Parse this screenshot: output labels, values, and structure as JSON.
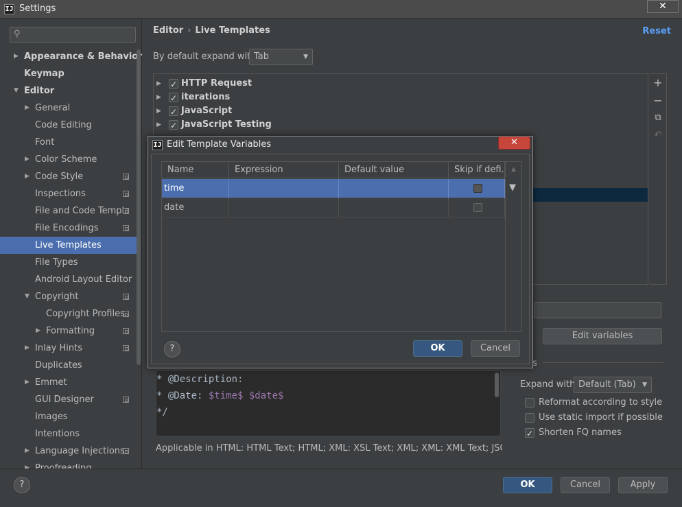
{
  "window": {
    "title": "Settings",
    "app_icon": "IJ",
    "close_glyph": "✕"
  },
  "search": {
    "placeholder": "",
    "icon": "search-icon"
  },
  "sidebar": {
    "items": [
      {
        "label": "Appearance & Behavior",
        "level": 0,
        "arrow": "▶",
        "bold": true
      },
      {
        "label": "Keymap",
        "level": 0,
        "arrow": "",
        "bold": true
      },
      {
        "label": "Editor",
        "level": 0,
        "arrow": "▼",
        "bold": true
      },
      {
        "label": "General",
        "level": 1,
        "arrow": "▶"
      },
      {
        "label": "Code Editing",
        "level": 1,
        "arrow": ""
      },
      {
        "label": "Font",
        "level": 1,
        "arrow": ""
      },
      {
        "label": "Color Scheme",
        "level": 1,
        "arrow": "▶"
      },
      {
        "label": "Code Style",
        "level": 1,
        "arrow": "▶",
        "project": true
      },
      {
        "label": "Inspections",
        "level": 1,
        "arrow": "",
        "project": true
      },
      {
        "label": "File and Code Templa",
        "level": 1,
        "arrow": "",
        "project": true
      },
      {
        "label": "File Encodings",
        "level": 1,
        "arrow": "",
        "project": true
      },
      {
        "label": "Live Templates",
        "level": 1,
        "arrow": "",
        "selected": true
      },
      {
        "label": "File Types",
        "level": 1,
        "arrow": ""
      },
      {
        "label": "Android Layout Editor",
        "level": 1,
        "arrow": ""
      },
      {
        "label": "Copyright",
        "level": 1,
        "arrow": "▼",
        "project": true
      },
      {
        "label": "Copyright Profiles",
        "level": 2,
        "arrow": "",
        "project": true
      },
      {
        "label": "Formatting",
        "level": 2,
        "arrow": "▶",
        "project": true
      },
      {
        "label": "Inlay Hints",
        "level": 1,
        "arrow": "▶",
        "project": true
      },
      {
        "label": "Duplicates",
        "level": 1,
        "arrow": ""
      },
      {
        "label": "Emmet",
        "level": 1,
        "arrow": "▶"
      },
      {
        "label": "GUI Designer",
        "level": 1,
        "arrow": "",
        "project": true
      },
      {
        "label": "Images",
        "level": 1,
        "arrow": ""
      },
      {
        "label": "Intentions",
        "level": 1,
        "arrow": ""
      },
      {
        "label": "Language Injections",
        "level": 1,
        "arrow": "▶",
        "project": true
      },
      {
        "label": "Proofreading",
        "level": 1,
        "arrow": "▶"
      }
    ]
  },
  "main": {
    "breadcrumb": {
      "parent": "Editor",
      "separator": "›",
      "current": "Live Templates"
    },
    "reset_label": "Reset",
    "expand_label": "By default expand with",
    "expand_value": "Tab",
    "template_groups": [
      {
        "label": "HTTP Request",
        "checked": true
      },
      {
        "label": "iterations",
        "checked": true
      },
      {
        "label": "JavaScript",
        "checked": true
      },
      {
        "label": "JavaScript Testing",
        "checked": true
      }
    ],
    "tools": {
      "add": "+",
      "remove": "−",
      "copy": "⧉",
      "restore": "↶"
    },
    "edit_variables_label": "Edit variables",
    "options_label": "s",
    "code_lines": [
      {
        "prefix": "* @Description:",
        "vars": ""
      },
      {
        "prefix": "* @Date: ",
        "vars": "$time$ $date$"
      },
      {
        "prefix": "*/",
        "vars": ""
      }
    ],
    "applicable_text": "Applicable in HTML: HTML Text; HTML; XML: XSL Text; XML; XML: XML Text; JSON; JSC",
    "expand_with_label": "Expand with",
    "expand_with_value": "Default (Tab)",
    "options": [
      {
        "label": "Reformat according to style",
        "checked": false
      },
      {
        "label": "Use static import if possible",
        "checked": false
      },
      {
        "label": "Shorten FQ names",
        "checked": true
      }
    ]
  },
  "bottom": {
    "help": "?",
    "ok": "OK",
    "cancel": "Cancel",
    "apply": "Apply"
  },
  "dialog": {
    "title": "Edit Template Variables",
    "close_glyph": "✕",
    "columns": [
      "Name",
      "Expression",
      "Default value",
      "Skip if defi..."
    ],
    "rows": [
      {
        "name": "time",
        "expression": "",
        "default_value": "",
        "skip": false,
        "selected": true
      },
      {
        "name": "date",
        "expression": "",
        "default_value": "",
        "skip": false,
        "selected": false
      }
    ],
    "help": "?",
    "ok": "OK",
    "cancel": "Cancel"
  },
  "colors": {
    "background": "#3c3f41",
    "selection": "#4b6eaf",
    "primary_button": "#365880",
    "link": "#589df6",
    "close_red": "#c7453a",
    "template_var": "#9876aa"
  }
}
